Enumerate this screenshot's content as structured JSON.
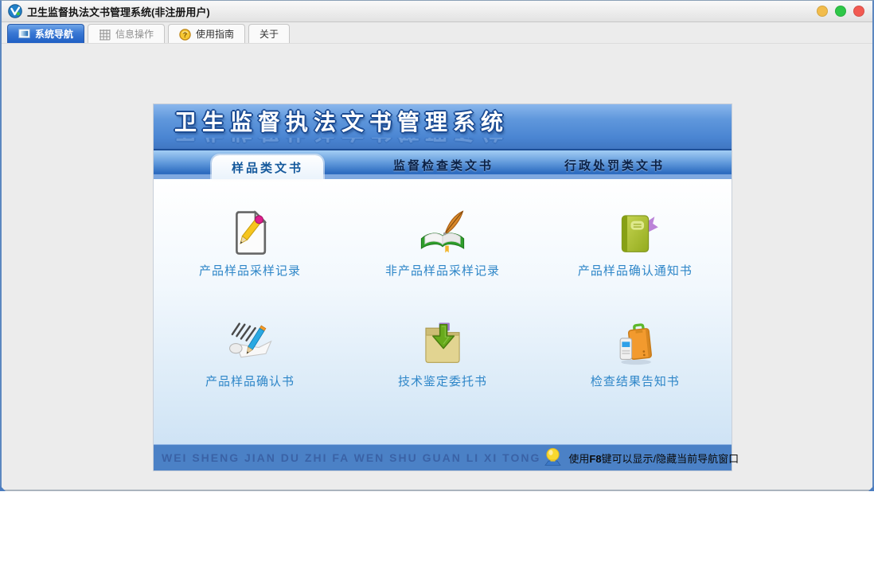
{
  "window": {
    "title": "卫生监督执法文书管理系统(非注册用户)",
    "app_icon": "app-logo-icon",
    "controls": {
      "minimize_color": "#f2bc4b",
      "zoom_color": "#2ec748",
      "close_color": "#f25a52"
    }
  },
  "nav_tabs": {
    "items": [
      {
        "label": "系统导航",
        "icon": "window-icon",
        "active": true
      },
      {
        "label": "信息操作",
        "icon": "grid-icon",
        "active": false
      },
      {
        "label": "使用指南",
        "icon": "help-icon",
        "active": false
      },
      {
        "label": "关于",
        "icon": "none",
        "active": false
      }
    ]
  },
  "panel": {
    "title": "卫生监督执法文书管理系统",
    "tabs": [
      {
        "label": "样品类文书",
        "active": true
      },
      {
        "label": "监督检查类文书",
        "active": false
      },
      {
        "label": "行政处罚类文书",
        "active": false
      }
    ],
    "items": [
      {
        "label": "产品样品采样记录",
        "icon": "document-pencil-icon"
      },
      {
        "label": "非产品样品采样记录",
        "icon": "book-quill-icon"
      },
      {
        "label": "产品样品确认通知书",
        "icon": "notebook-ribbon-icon"
      },
      {
        "label": "产品样品确认书",
        "icon": "scroll-pencil-icon"
      },
      {
        "label": "技术鉴定委托书",
        "icon": "folder-download-icon"
      },
      {
        "label": "检查结果告知书",
        "icon": "briefcase-device-icon"
      }
    ],
    "footer": {
      "watermark": "WEI SHENG JIAN DU ZHI FA WEN SHU GUAN LI XI TONG",
      "icon": "lightbulb-icon",
      "hint_prefix": "使用",
      "hint_key": "F8",
      "hint_suffix": "键可以显示/隐藏当前导航窗口"
    }
  },
  "colors": {
    "accent_blue": "#2e6cc0",
    "label_blue": "#2e86c8",
    "footer_blue": "#4b81c6",
    "header_blue": "#4a85d2"
  }
}
